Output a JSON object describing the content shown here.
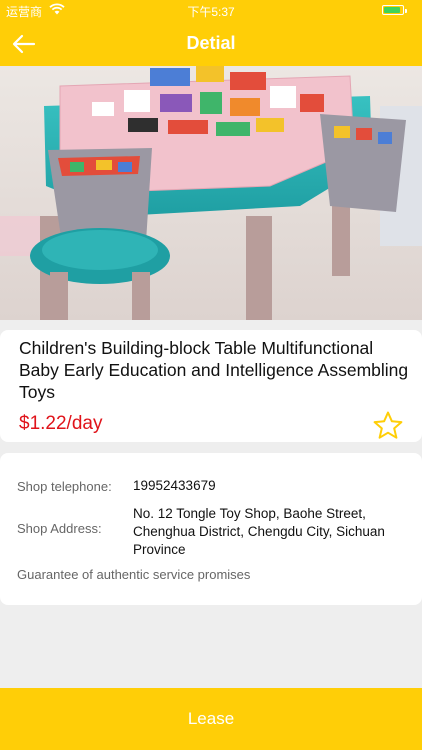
{
  "status_bar": {
    "carrier": "运营商",
    "time": "下午5:37"
  },
  "nav": {
    "title": "Detial",
    "back_icon": "arrow-left-icon"
  },
  "product": {
    "image_subject": "children building-block table with stool and toy blocks",
    "name": "Children's Building-block Table Multifunctional Baby Early Education and Intelligence Assembling Toys",
    "price": "$1.22/day",
    "favorite_icon": "star-outline-icon"
  },
  "shop": {
    "telephone_label": "Shop telephone:",
    "telephone_value": "19952433679",
    "address_label": "Shop Address:",
    "address_value": "No. 12 Tongle Toy Shop, Baohe Street, Chenghua District, Chengdu City, Sichuan Province",
    "guarantee": "Guarantee of authentic service promises"
  },
  "actions": {
    "lease_label": "Lease"
  },
  "colors": {
    "brand_yellow": "#ffce07",
    "price_red": "#e0131a",
    "background": "#eeeeee"
  }
}
